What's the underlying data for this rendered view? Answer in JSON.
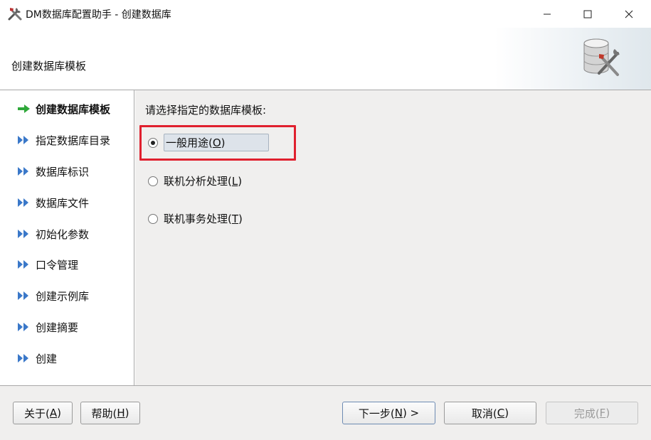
{
  "window": {
    "title": "DM数据库配置助手 - 创建数据库",
    "app_icon": "tools-icon",
    "controls": [
      "minimize-icon",
      "maximize-icon",
      "close-icon"
    ]
  },
  "header": {
    "title": "创建数据库模板",
    "icon": "database-tools-icon"
  },
  "nav": {
    "items": [
      {
        "label": "创建数据库模板",
        "state": "current"
      },
      {
        "label": "指定数据库目录",
        "state": "pending"
      },
      {
        "label": "数据库标识",
        "state": "pending"
      },
      {
        "label": "数据库文件",
        "state": "pending"
      },
      {
        "label": "初始化参数",
        "state": "pending"
      },
      {
        "label": "口令管理",
        "state": "pending"
      },
      {
        "label": "创建示例库",
        "state": "pending"
      },
      {
        "label": "创建摘要",
        "state": "pending"
      },
      {
        "label": "创建",
        "state": "pending"
      }
    ]
  },
  "content": {
    "prompt": "请选择指定的数据库模板:",
    "options": [
      {
        "text": "一般用途(",
        "mnemonic": "O",
        "suffix": ")",
        "selected": true
      },
      {
        "text": "联机分析处理(",
        "mnemonic": "L",
        "suffix": ")",
        "selected": false
      },
      {
        "text": "联机事务处理(",
        "mnemonic": "T",
        "suffix": ")",
        "selected": false
      }
    ]
  },
  "footer": {
    "about": {
      "text": "关于(",
      "mnemonic": "A",
      "suffix": ")"
    },
    "help": {
      "text": "帮助(",
      "mnemonic": "H",
      "suffix": ")"
    },
    "next": {
      "text": "下一步(",
      "mnemonic": "N",
      "suffix": ") >"
    },
    "cancel": {
      "text": "取消(",
      "mnemonic": "C",
      "suffix": ")"
    },
    "finish": {
      "text": "完成(",
      "mnemonic": "F",
      "suffix": ")",
      "enabled": false
    }
  },
  "colors": {
    "highlight": "#e0202e",
    "current_arrow": "#2fa83a",
    "pending_arrow": "#3a78c9"
  }
}
